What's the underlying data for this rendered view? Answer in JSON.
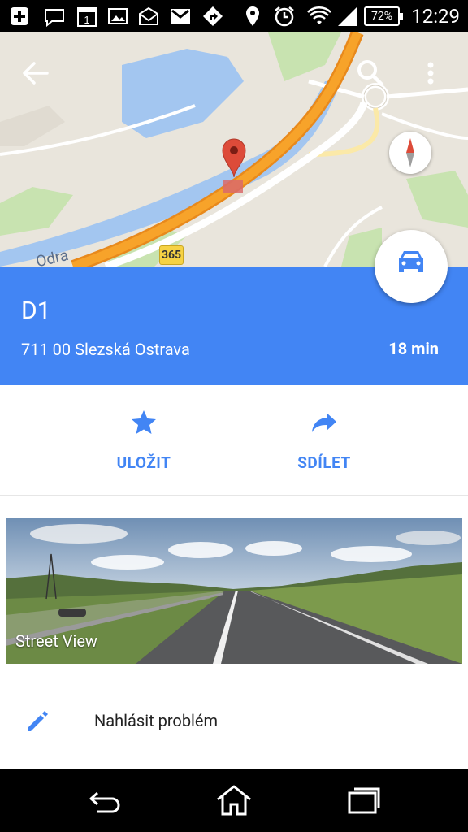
{
  "status_bar": {
    "battery": "72%",
    "time": "12:29",
    "icons": [
      "plus-icon",
      "chat-icon",
      "calendar-icon",
      "image-icon",
      "mail-icon",
      "gmail-icon",
      "navigation-icon",
      "location-icon",
      "alarm-icon",
      "wifi-icon",
      "signal-icon"
    ]
  },
  "map": {
    "river_label": "Odra",
    "road_number": "365",
    "colors": {
      "water": "#a3c6f0",
      "highway": "#f7a32a",
      "park": "#c8e3b0",
      "land": "#e9e5dc",
      "marker": "#dd4b39"
    }
  },
  "place": {
    "title": "D1",
    "address": "711 00 Slezská Ostrava",
    "travel_time": "18 min",
    "accent": "#4285f4"
  },
  "actions": {
    "save_label": "ULOŽIT",
    "share_label": "SDÍLET"
  },
  "street_view": {
    "label": "Street View"
  },
  "report": {
    "label": "Nahlásit problém"
  }
}
